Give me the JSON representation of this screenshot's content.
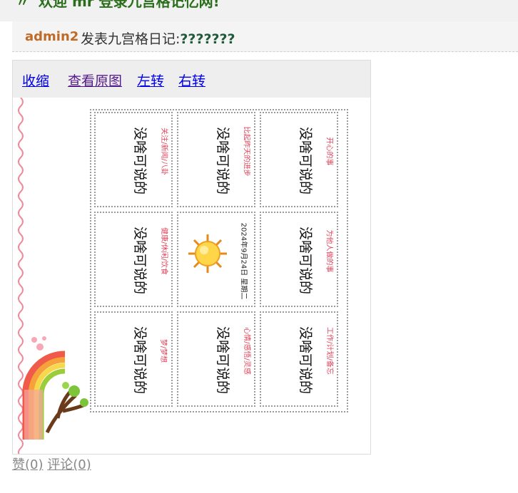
{
  "header": {
    "welcome": "欢迎 mr 登录九宫格记忆网!",
    "arrow": "〃"
  },
  "post": {
    "author": "admin2",
    "action": "发表九宫格日记:",
    "title": "???????"
  },
  "toolbar": {
    "collapse": "收缩",
    "view_original": "查看原图",
    "rotate_left": "左转",
    "rotate_right": "右转"
  },
  "grid": {
    "cells": [
      {
        "main": "没啥可说的",
        "sub": "开心的事"
      },
      {
        "main": "没啥可说的",
        "sub": "比起昨天的进步"
      },
      {
        "main": "没啥可说的",
        "sub": "关注/新闻/八卦"
      },
      {
        "main": "没啥可说的",
        "sub": "为他人做的事"
      },
      {
        "date": "2024年9月24日 星期二"
      },
      {
        "main": "没啥可说的",
        "sub": "健康/休闲/饮食"
      },
      {
        "main": "没啥可说的",
        "sub": "工作/计划/备忘"
      },
      {
        "main": "没啥可说的",
        "sub": "心情/感悟/灵感"
      },
      {
        "main": "没啥可说的",
        "sub": "梦/梦想"
      }
    ]
  },
  "footer": {
    "like": "赞(0)",
    "comment": "评论(0)"
  },
  "colors": {
    "welcome": "#2a6e1b",
    "author": "#c06a26",
    "link": "#0000ee",
    "sub_label": "#e0445a"
  }
}
